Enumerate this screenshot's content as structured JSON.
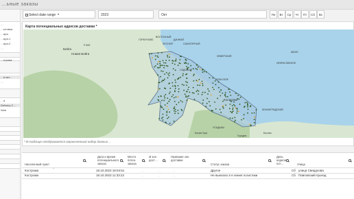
{
  "app": {
    "title": "…ьные заказы"
  },
  "sidebar": {
    "items": [
      {
        "label": "…"
      },
      {
        "label": "…ытовка"
      },
      {
        "label": "…ира"
      },
      {
        "label": "…ира-1"
      },
      {
        "label": "…ира-2"
      },
      {
        "label": "…"
      },
      {
        "label": "…ктрова"
      }
    ],
    "section2": [
      {
        "label": "…и кат…"
      },
      {
        "label": "…"
      }
    ],
    "section3": [
      {
        "label": "…а"
      },
      {
        "label": "Delivery C…"
      },
      {
        "label": "Web"
      }
    ]
  },
  "filters": {
    "date_range": "Select date range",
    "year": "2023",
    "month": "Окт",
    "days": [
      "Пн",
      "Вт",
      "Ср",
      "Чт",
      "Пт",
      "Сб",
      "Вс"
    ]
  },
  "map_panel": {
    "title": "Карта потенциальных адресов доставки *",
    "note": "* В таблице отображается ограниченный набор данных…",
    "labels": {
      "beega": "Бейга",
      "new_beega": "Новая Бейга",
      "road": "Р-600",
      "eastern": "ВОСТОЧНЫЙ",
      "kostroma": "Кострома",
      "nekrasovskoe": "НЕКРАСОВСКОЕ",
      "kosaya_gora": "Косая Гора",
      "lesnoi": "ЛЕСНОЙ",
      "sanatoriy": "САНАТОРНЫЙ",
      "dachnyy": "ДАЧНЫЙ",
      "gorbunovo": "ГОРБУНОВО",
      "usadby": "УСАДЬБЫ",
      "shein": "ШЕИН",
      "leningradskiy": "ЛЕНИНГРАДСКИЙ",
      "gorodnya": "Городня",
      "bosovo": "Босово",
      "sadovyy": "САДОВЫЙ",
      "selskoe": "СЕЛЬСКОЕ",
      "neverskiy": "НЕВЕРСКИЙ"
    }
  },
  "table": {
    "headers": [
      "Населенный пункт",
      "Дата и время потенциального заказа",
      "Место потен. заказа",
      "id зон дост…",
      "Название зон доставки",
      "Статус заказа",
      "День недели пот…",
      "Улица"
    ],
    "rows": [
      {
        "city": "Кострома",
        "datetime": "18.10.2023 18:04:51",
        "place": "…",
        "zone_id": "…",
        "zone_name": "…",
        "status": "Другое",
        "weekday": "Сб",
        "street": "улица Свердлова"
      },
      {
        "city": "Кострома",
        "datetime": "18.10.2023 11:33:22",
        "place": "…",
        "zone_id": "…",
        "zone_name": "…",
        "status": "Не выехала 2-я линия логистики",
        "weekday": "Сб",
        "street": "Павловский проезд"
      }
    ]
  },
  "colors": {
    "water": "#a9d3ea",
    "land": "#d9e7d2",
    "forest": "#b7d2a7",
    "zone_fill": "#a6c8e0",
    "zone_stroke": "#5a6f8a",
    "dot": "#2f5a1e",
    "dot_alt": "#e8a020"
  }
}
